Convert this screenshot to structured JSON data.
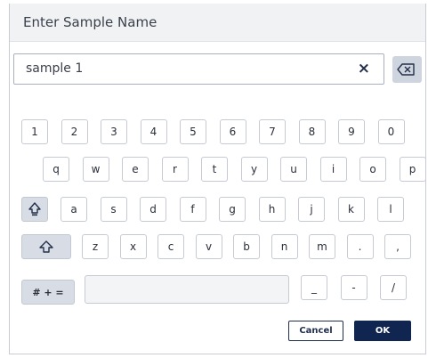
{
  "dialog": {
    "title": "Enter Sample Name"
  },
  "input": {
    "value": "sample 1",
    "clear_icon": "×"
  },
  "keyboard": {
    "row1": [
      "1",
      "2",
      "3",
      "4",
      "5",
      "6",
      "7",
      "8",
      "9",
      "0"
    ],
    "row2": [
      "q",
      "w",
      "e",
      "r",
      "t",
      "y",
      "u",
      "i",
      "o",
      "p"
    ],
    "row3": [
      "a",
      "s",
      "d",
      "f",
      "g",
      "h",
      "j",
      "k",
      "l"
    ],
    "row4": [
      "z",
      "x",
      "c",
      "v",
      "b",
      "n",
      "m",
      ".",
      ","
    ],
    "row5": [
      "_",
      "-",
      "/"
    ],
    "caps_icon": "caps-lock-icon",
    "shift_icon": "shift-icon",
    "symbols_label": "# + ="
  },
  "actions": {
    "cancel_label": "Cancel",
    "ok_label": "OK"
  },
  "colors": {
    "accent": "#10254f",
    "modifier_key": "#d8dde5"
  }
}
